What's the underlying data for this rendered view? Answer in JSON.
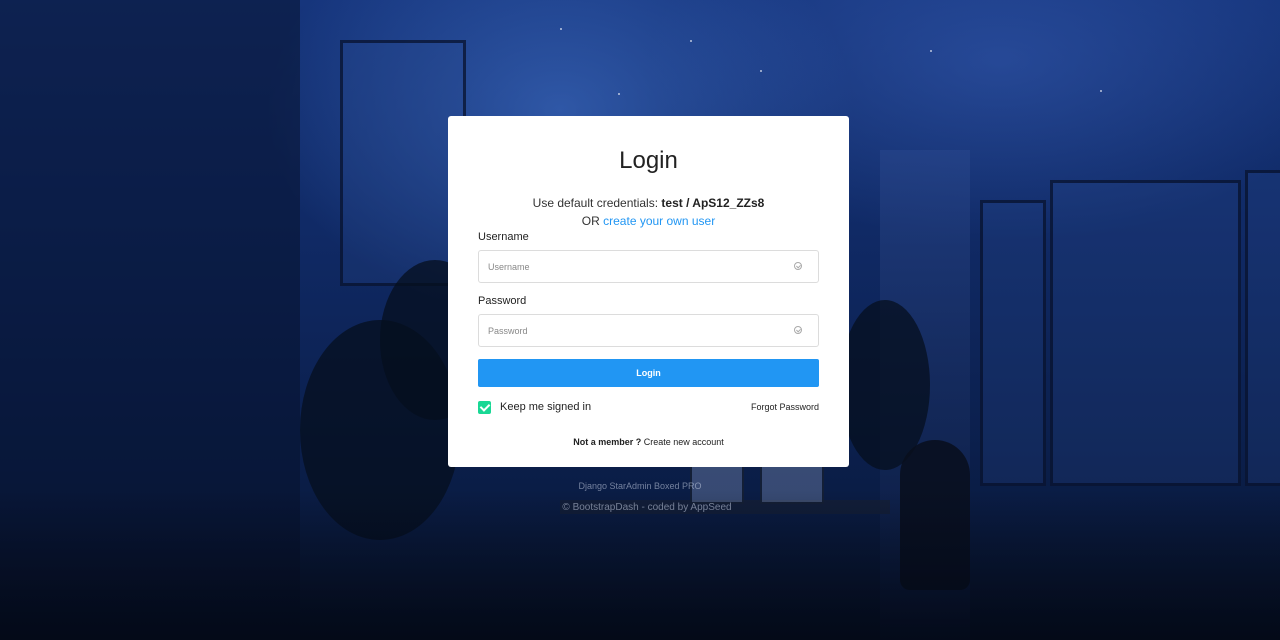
{
  "card": {
    "title": "Login",
    "credentials_prefix": "Use default credentials:",
    "credentials_value": "test / ApS12_ZZs8",
    "or_text": "OR",
    "create_user_link": "create your own user"
  },
  "form": {
    "username_label": "Username",
    "username_placeholder": "Username",
    "username_value": "",
    "password_label": "Password",
    "password_placeholder": "Password",
    "password_value": "",
    "login_button": "Login",
    "keep_signed_in": "Keep me signed in",
    "keep_signed_in_checked": true,
    "forgot_password": "Forgot Password",
    "not_member": "Not a member ?",
    "create_account": "Create new account"
  },
  "footer": {
    "brand": "Django StarAdmin Boxed PRO",
    "copyright": "© BootstrapDash - coded by AppSeed"
  },
  "colors": {
    "primary": "#2196f3",
    "checkbox": "#19d895",
    "background": "#102a66"
  },
  "icons": {
    "field_status": "check-circle-icon",
    "checkbox": "checkmark-icon"
  }
}
